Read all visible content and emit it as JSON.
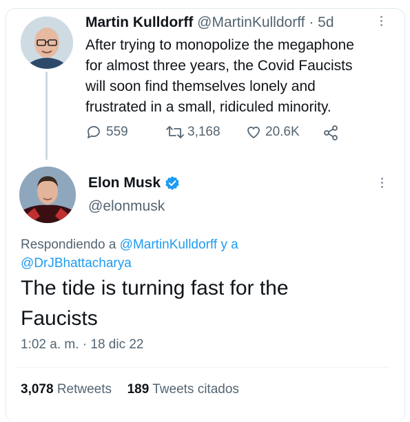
{
  "quoted_tweet": {
    "author_name": "Martin Kulldorff",
    "author_handle": "@MartinKulldorff",
    "separator": "·",
    "age": "5d",
    "text_lines": [
      "After trying to monopolize the megaphone",
      "for almost three years, the Covid Faucists",
      "will soon find themselves lonely and",
      "frustrated in a small, ridiculed minority."
    ],
    "replies": "559",
    "retweets": "3,168",
    "likes": "20.6K"
  },
  "main_tweet": {
    "author_name": "Elon Musk",
    "author_handle": "@elonmusk",
    "replying_prefix": "Respondiendo a",
    "replying_to_1": "@MartinKulldorff",
    "replying_joiner": "y a",
    "replying_to_2": "@DrJBhattacharya",
    "text_lines": [
      "The tide is turning fast for the",
      "Faucists"
    ],
    "time": "1:02 a. m.",
    "time_separator": "·",
    "date": "18 dic 22",
    "retweet_count": "3,078",
    "retweet_label": "Retweets",
    "quote_count": "189",
    "quote_label": "Tweets citados"
  },
  "colors": {
    "accent": "#1d9bf0",
    "muted": "#536471",
    "verified": "#1d9bf0"
  },
  "icons": [
    "reply-icon",
    "retweet-icon",
    "like-icon",
    "share-icon",
    "more-icon",
    "verified-badge-icon"
  ]
}
